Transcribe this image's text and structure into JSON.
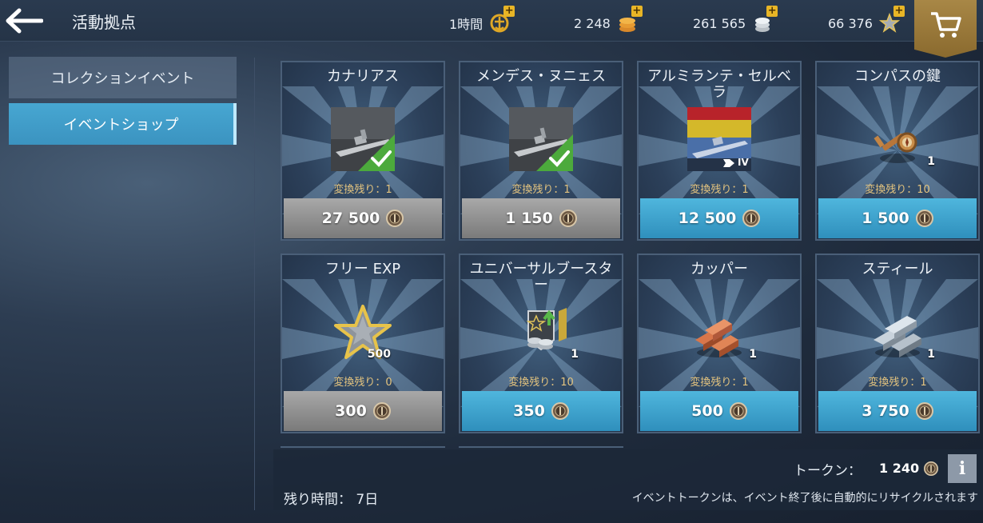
{
  "header": {
    "title": "活動拠点",
    "resources": [
      {
        "value": "1時間",
        "icon": "premium-account-icon"
      },
      {
        "value": "2 248",
        "icon": "gold-coins-icon"
      },
      {
        "value": "261 565",
        "icon": "credits-icon"
      },
      {
        "value": "66 376",
        "icon": "free-exp-star-icon"
      }
    ],
    "cart_icon": "shopping-cart-icon"
  },
  "sidebar": {
    "items": [
      {
        "label": "コレクションイベント",
        "active": false
      },
      {
        "label": "イベントショップ",
        "active": true
      }
    ]
  },
  "shop": {
    "items": [
      {
        "name": "カナリアス",
        "remain": "変換残り：1",
        "price": "27 500",
        "state": "owned",
        "icon": "battleship-canarias-icon"
      },
      {
        "name": "メンデス・ヌニェス",
        "remain": "変換残り：1",
        "price": "1 150",
        "state": "owned",
        "icon": "cruiser-mendez-nunez-icon"
      },
      {
        "name": "アルミランテ・セルベラ",
        "remain": "変換残り：1",
        "price": "12 500",
        "state": "available",
        "icon": "cruiser-almirante-cervera-icon",
        "tier": "IV"
      },
      {
        "name": "コンパスの鍵",
        "remain": "変換残り：10",
        "price": "1 500",
        "state": "available",
        "icon": "compass-key-icon",
        "qty": "1"
      },
      {
        "name": "フリー EXP",
        "remain": "変換残り：0",
        "price": "300",
        "state": "sold-out",
        "icon": "free-exp-star-icon",
        "qty": "500"
      },
      {
        "name": "ユニバーサルブースター",
        "remain": "変換残り：10",
        "price": "350",
        "state": "available",
        "icon": "universal-booster-icon",
        "qty": "1"
      },
      {
        "name": "カッパー",
        "remain": "変換残り：1",
        "price": "500",
        "state": "available",
        "icon": "copper-ingots-icon",
        "qty": "1"
      },
      {
        "name": "スティール",
        "remain": "変換残り：1",
        "price": "3 750",
        "state": "available",
        "icon": "steel-ingots-icon",
        "qty": "1"
      }
    ]
  },
  "footer": {
    "time_left": "残り時間： 7日",
    "token_label": "トークン：",
    "token_value": "1 240",
    "note": "イベントトークンは、イベント終了後に自動的にリサイクルされます",
    "info_label": "i"
  },
  "colors": {
    "accent_blue": "#3b93c0",
    "gold": "#e8b526",
    "owned_check": "#4caa3c"
  }
}
